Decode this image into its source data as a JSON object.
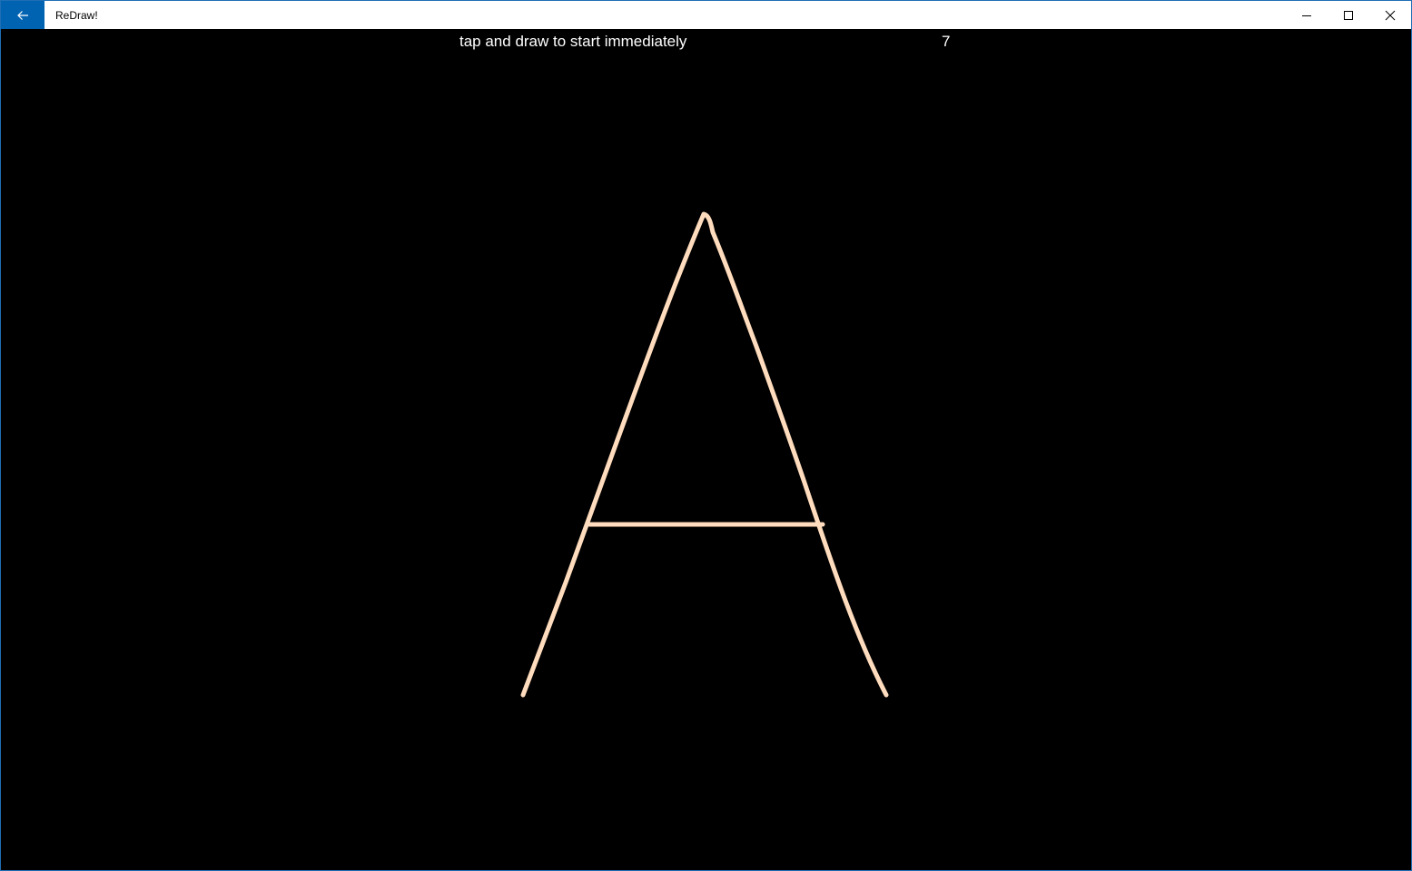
{
  "window": {
    "title": "ReDraw!"
  },
  "icons": {
    "back": "back-arrow-icon",
    "minimize": "minimize-icon",
    "maximize": "maximize-icon",
    "close": "close-icon"
  },
  "main": {
    "prompt": "tap and draw to start immediately",
    "countdown": "7"
  },
  "colors": {
    "accent": "#0063b1",
    "stroke": "#ffdcbd",
    "background": "#000000"
  }
}
